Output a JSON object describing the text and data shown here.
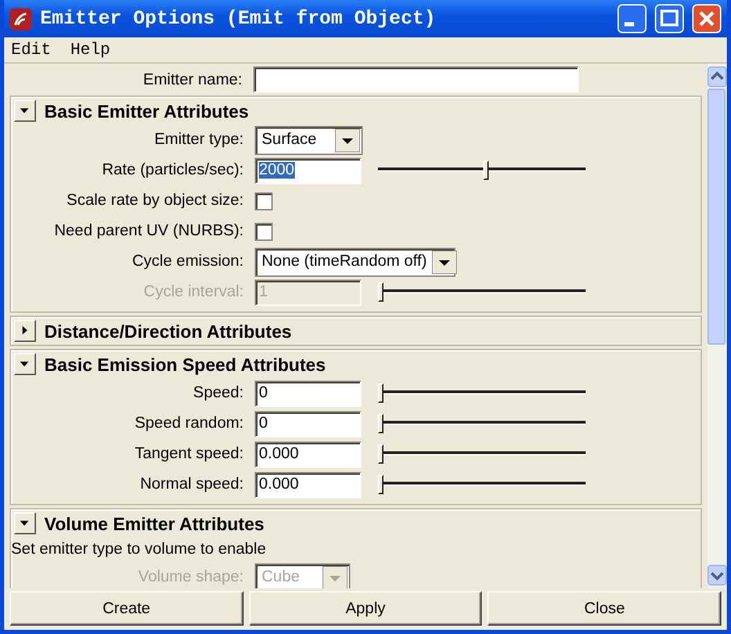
{
  "window": {
    "title": "Emitter Options (Emit from Object)"
  },
  "menu": [
    "Edit",
    "Help"
  ],
  "emitter_name": {
    "label": "Emitter name:"
  },
  "sections": [
    {
      "title": "Basic Emitter Attributes",
      "expanded": true,
      "rows": [
        {
          "kind": "dropdown",
          "label": "Emitter type:",
          "value": "Surface",
          "disabled": false
        },
        {
          "kind": "number",
          "label": "Rate (particles/sec):",
          "value": "2000",
          "text_selected": true,
          "level": 0.52,
          "disabled": false
        },
        {
          "kind": "checkbox",
          "label": "Scale rate by object size:",
          "checked": false
        },
        {
          "kind": "checkbox",
          "label": "Need parent UV (NURBS):",
          "checked": false
        },
        {
          "kind": "dropdown",
          "label": "Cycle emission:",
          "value": "None (timeRandom off)",
          "disabled": false
        },
        {
          "kind": "number",
          "label": "Cycle interval:",
          "value": "1",
          "text_selected": false,
          "level": 0,
          "disabled": true
        }
      ]
    },
    {
      "title": "Distance/Direction Attributes",
      "expanded": false
    },
    {
      "title": "Basic Emission Speed Attributes",
      "expanded": true,
      "rows": [
        {
          "kind": "number",
          "label": "Speed:",
          "value": "0",
          "text_selected": false,
          "level": 0,
          "disabled": false
        },
        {
          "kind": "number",
          "label": "Speed random:",
          "value": "0",
          "text_selected": false,
          "level": 0,
          "disabled": false
        },
        {
          "kind": "number",
          "label": "Tangent speed:",
          "value": "0.000",
          "text_selected": false,
          "level": 0,
          "disabled": false
        },
        {
          "kind": "number",
          "label": "Normal speed:",
          "value": "0.000",
          "text_selected": false,
          "level": 0,
          "disabled": false
        }
      ]
    },
    {
      "title": "Volume Emitter Attributes",
      "expanded": true,
      "rows": [
        {
          "kind": "note",
          "label": "Set emitter type to volume to enable"
        },
        {
          "kind": "dropdown",
          "label": "Volume shape:",
          "value": "Cube",
          "disabled": true
        }
      ]
    }
  ],
  "buttons": [
    "Create",
    "Apply",
    "Close"
  ]
}
